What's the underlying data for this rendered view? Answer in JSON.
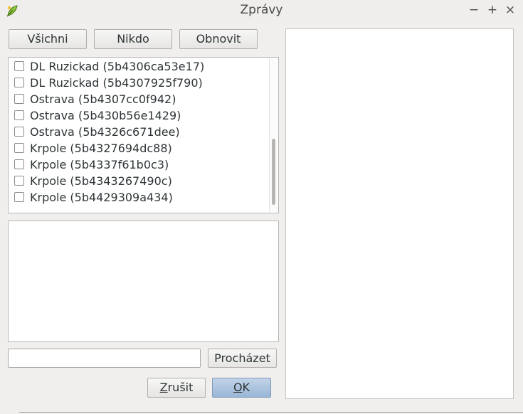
{
  "window": {
    "title": "Zprávy",
    "minimize_glyph": "−",
    "maximize_glyph": "+",
    "close_glyph": "×",
    "app_icon": "qgis-leaf-icon"
  },
  "toolbar": {
    "all_label": "Všichni",
    "none_label": "Nikdo",
    "refresh_label": "Obnovit"
  },
  "list": {
    "items": [
      {
        "label": "DL Ruzickad (5b4306ca53e17)",
        "checked": false
      },
      {
        "label": "DL Ruzickad (5b4307925f790)",
        "checked": false
      },
      {
        "label": "Ostrava (5b4307cc0f942)",
        "checked": false
      },
      {
        "label": "Ostrava (5b430b56e1429)",
        "checked": false
      },
      {
        "label": "Ostrava (5b4326c671dee)",
        "checked": false
      },
      {
        "label": "Krpole (5b4327694dc88)",
        "checked": false
      },
      {
        "label": "Krpole (5b4337f61b0c3)",
        "checked": false
      },
      {
        "label": "Krpole (5b4343267490c)",
        "checked": false
      },
      {
        "label": "Krpole (5b4429309a434)",
        "checked": false
      }
    ]
  },
  "browse": {
    "path_value": "",
    "browse_label": "Procházet"
  },
  "dialog_buttons": {
    "cancel_mnemonic": "Z",
    "cancel_rest": "rušit",
    "ok_mnemonic": "O",
    "ok_rest": "K"
  },
  "colors": {
    "accent_button": "#9ab6d6",
    "window_bg": "#f0efee"
  }
}
